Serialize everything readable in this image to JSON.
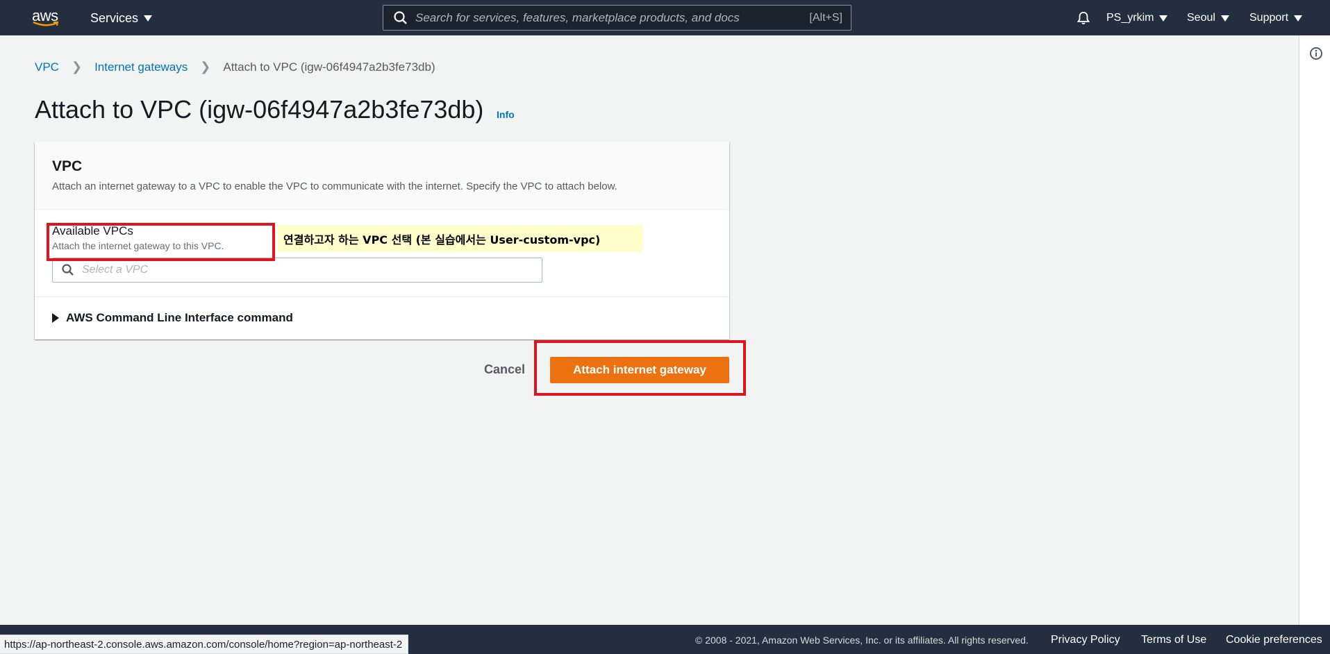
{
  "topnav": {
    "logo_text": "aws",
    "services_label": "Services",
    "search_placeholder": "Search for services, features, marketplace products, and docs",
    "search_shortcut": "[Alt+S]",
    "user_label": "PS_yrkim",
    "region_label": "Seoul",
    "support_label": "Support"
  },
  "breadcrumb": {
    "items": [
      "VPC",
      "Internet gateways"
    ],
    "current": "Attach to VPC (igw-06f4947a2b3fe73db)"
  },
  "page": {
    "title": "Attach to VPC (igw-06f4947a2b3fe73db)",
    "info_label": "Info"
  },
  "panel": {
    "heading": "VPC",
    "description": "Attach an internet gateway to a VPC to enable the VPC to communicate with the internet. Specify the VPC to attach below.",
    "field_label": "Available VPCs",
    "field_description": "Attach the internet gateway to this VPC.",
    "select_placeholder": "Select a VPC",
    "cli_label": "AWS Command Line Interface command"
  },
  "annotation": {
    "text": "연결하고자 하는 VPC 선택 (본 실습에서는 User-custom-vpc)"
  },
  "actions": {
    "cancel_label": "Cancel",
    "attach_label": "Attach internet gateway"
  },
  "footer": {
    "status_url": "https://ap-northeast-2.console.aws.amazon.com/console/home?region=ap-northeast-2",
    "copyright": "© 2008 - 2021, Amazon Web Services, Inc. or its affiliates. All rights reserved.",
    "privacy_label": "Privacy Policy",
    "terms_label": "Terms of Use",
    "cookie_label": "Cookie preferences"
  },
  "colors": {
    "nav_bg": "#232f3e",
    "primary_button": "#ec7211",
    "link": "#0073bb",
    "annotation_bg": "#ffffcc",
    "highlight_border": "#e0141e"
  },
  "icons": [
    "aws-logo-icon",
    "search-icon",
    "bell-icon",
    "info-circle-icon",
    "caret-right-icon"
  ]
}
